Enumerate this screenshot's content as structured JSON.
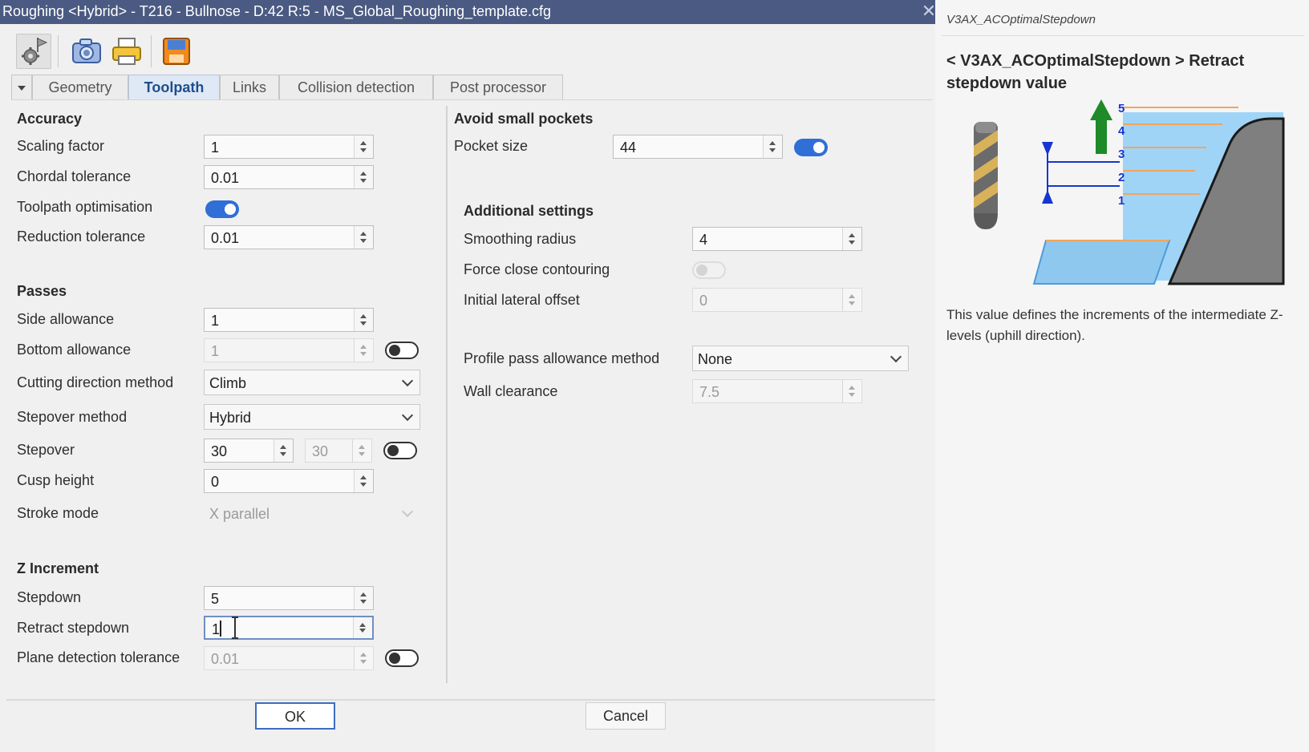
{
  "window": {
    "title": "Roughing <Hybrid> - T216 - Bullnose - D:42 R:5 - MS_Global_Roughing_template.cfg",
    "close_glyph": "✕"
  },
  "toolbar": {
    "icons": [
      "settings-flag-icon",
      "camera-icon",
      "printer-icon",
      "save-icon"
    ]
  },
  "tabs": [
    "Geometry",
    "Toolpath",
    "Links",
    "Collision detection",
    "Post processor"
  ],
  "active_tab": "Toolpath",
  "accuracy": {
    "heading": "Accuracy",
    "scaling_factor": {
      "label": "Scaling factor",
      "value": "1"
    },
    "chordal_tolerance": {
      "label": "Chordal tolerance",
      "value": "0.01"
    },
    "toolpath_optimisation": {
      "label": "Toolpath optimisation",
      "enabled": true
    },
    "reduction_tolerance": {
      "label": "Reduction tolerance",
      "value": "0.01"
    }
  },
  "passes": {
    "heading": "Passes",
    "side_allowance": {
      "label": "Side allowance",
      "value": "1"
    },
    "bottom_allowance": {
      "label": "Bottom allowance",
      "value": "1",
      "enabled": false
    },
    "cutting_direction_method": {
      "label": "Cutting direction method",
      "value": "Climb"
    },
    "stepover_method": {
      "label": "Stepover method",
      "value": "Hybrid"
    },
    "stepover": {
      "label": "Stepover",
      "value": "30",
      "value2": "30",
      "enabled": false
    },
    "cusp_height": {
      "label": "Cusp height",
      "value": "0"
    },
    "stroke_mode": {
      "label": "Stroke mode",
      "value": "X parallel"
    }
  },
  "z_increment": {
    "heading": "Z Increment",
    "stepdown": {
      "label": "Stepdown",
      "value": "5"
    },
    "retract_stepdown": {
      "label": "Retract stepdown",
      "value": "1"
    },
    "plane_detection_tolerance": {
      "label": "Plane detection tolerance",
      "value": "0.01",
      "enabled": false
    }
  },
  "avoid_small_pockets": {
    "heading": "Avoid small pockets",
    "pocket_size": {
      "label": "Pocket size",
      "value": "44",
      "enabled": true
    }
  },
  "additional_settings": {
    "heading": "Additional settings",
    "smoothing_radius": {
      "label": "Smoothing radius",
      "value": "4"
    },
    "force_close_contouring": {
      "label": "Force close contouring",
      "enabled": false
    },
    "initial_lateral_offset": {
      "label": "Initial lateral offset",
      "value": "0"
    },
    "profile_pass_allowance_method": {
      "label": "Profile pass allowance method",
      "value": "None"
    },
    "wall_clearance": {
      "label": "Wall clearance",
      "value": "7.5"
    }
  },
  "buttons": {
    "ok": "OK",
    "cancel": "Cancel"
  },
  "help": {
    "header": "V3AX_ACOptimalStepdown",
    "title": "< V3AX_ACOptimalStepdown > Retract stepdown value",
    "description": "This value defines the increments of the intermediate Z-levels (uphill direction).",
    "diagram_levels": [
      "1",
      "2",
      "3",
      "4",
      "5"
    ]
  },
  "colors": {
    "titlebar": "#4a5a82",
    "toggle_on": "#2f6fd6",
    "focus_border": "#6f8fc4",
    "diagram_wall": "#7f7f7f",
    "diagram_floor": "#8fc8ef",
    "diagram_level_line": "#f0a55c",
    "diagram_arrow_green": "#1e8a28",
    "diagram_arrow_blue": "#1636d0"
  }
}
